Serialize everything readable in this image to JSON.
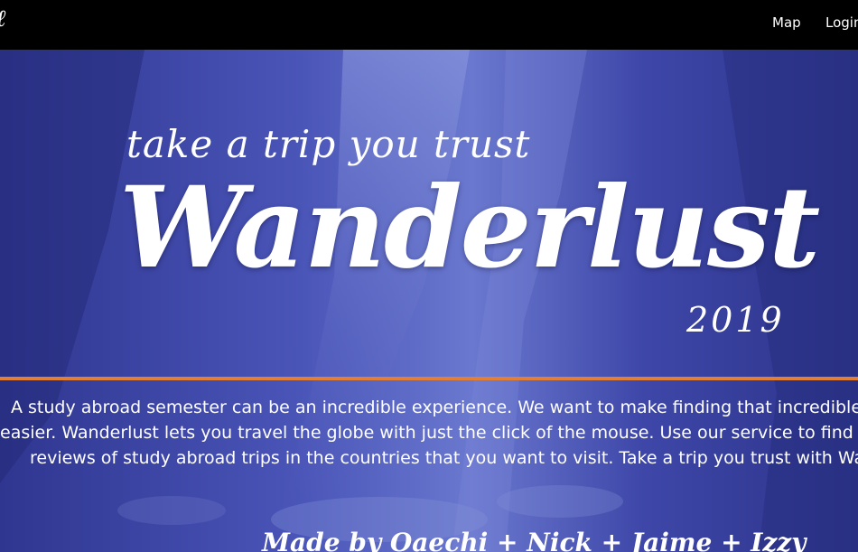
{
  "colors": {
    "navbar": "#000000",
    "hero_overlay": "#3b42a3",
    "divider": "#e07f35",
    "text": "#ffffff"
  },
  "navbar": {
    "brand_glyph": "ℓ",
    "links": [
      {
        "label": "Map"
      },
      {
        "label": "Login"
      }
    ]
  },
  "hero": {
    "background_image": "canyon-photo",
    "tagline": "take a trip you trust",
    "title": "Wanderlust",
    "year": "2019",
    "description_lines": [
      "A study abroad semester can be an incredible experience. We want to make finding that incredible ex",
      "easier. Wanderlust lets you travel the globe with just the click of the mouse. Use our service to find real",
      "reviews of study abroad trips in the countries that you want to visit. Take a trip you trust with Wand"
    ],
    "credits": "Made by Oaechi + Nick + Jaime + Izzy"
  }
}
